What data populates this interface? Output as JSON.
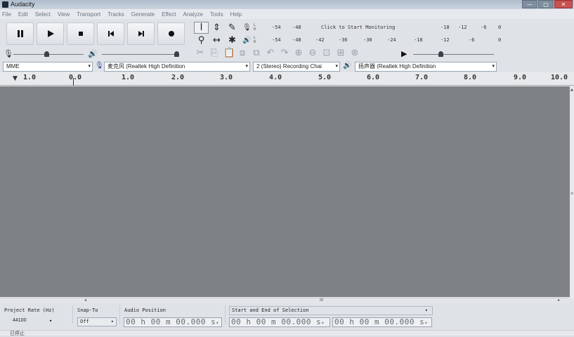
{
  "window": {
    "title": "Audacity",
    "min_label": "—",
    "max_label": "▢",
    "close_label": "✕"
  },
  "menu": [
    "File",
    "Edit",
    "Select",
    "View",
    "Transport",
    "Tracks",
    "Generate",
    "Effect",
    "Analyze",
    "Tools",
    "Help"
  ],
  "meters": {
    "record_scale": [
      "-54",
      "-48",
      "-12",
      "-6",
      "0"
    ],
    "monitor_label": "Click to Start Monitoring",
    "record_extra": [
      "-18"
    ],
    "play_scale": [
      "-54",
      "-48",
      "-42",
      "-36",
      "-30",
      "-24",
      "-18",
      "-12",
      "-6",
      "0"
    ]
  },
  "devices": {
    "host": "MME",
    "recording_device": "麦克风 (Realtek High Definition",
    "channels": "2 (Stereo) Recording Chai",
    "playback_device": "扬声器 (Realtek High Definition"
  },
  "ruler": {
    "ticks": [
      "1.0",
      "0.0",
      "1.0",
      "2.0",
      "3.0",
      "4.0",
      "5.0",
      "6.0",
      "7.0",
      "8.0",
      "9.0",
      "10.0"
    ]
  },
  "selection_toolbar": {
    "project_rate_label": "Project Rate (Hz)",
    "project_rate_value": "44100",
    "snap_to_label": "Snap-To",
    "snap_to_value": "Off",
    "audio_position_label": "Audio Position",
    "audio_position_value": "00 h 00 m 00.000 s",
    "selection_label": "Start and End of Selection",
    "selection_start": "00 h 00 m 00.000 s",
    "selection_end": "00 h 00 m 00.000 s"
  },
  "hscroll": {
    "center_mark": "III"
  },
  "status": {
    "text": "已停止"
  }
}
